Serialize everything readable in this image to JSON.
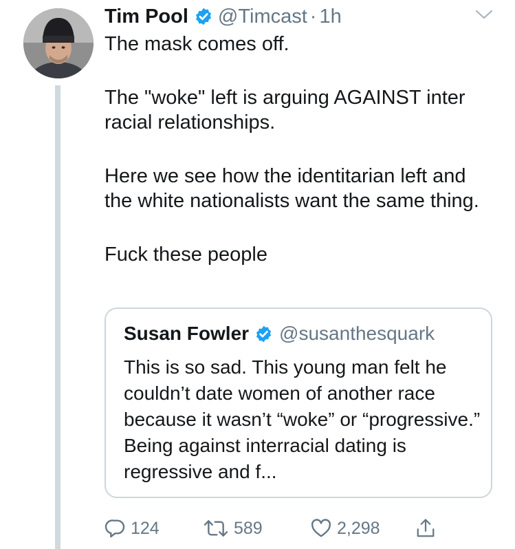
{
  "tweet": {
    "author_name": "Tim Pool",
    "handle": "@Timcast",
    "separator": "·",
    "time": "1h",
    "paragraphs": [
      "The mask comes off.",
      "The \"woke\" left is arguing AGAINST inter racial relationships.",
      "Here we see how the identitarian left and the white nationalists want the same thing.",
      "Fuck these people"
    ]
  },
  "quoted_tweet": {
    "author_name": "Susan Fowler",
    "handle": "@susanthesquark",
    "text": "This is so sad. This young man felt he couldn’t date women of another race because it wasn’t “woke” or “progressive.” Being against interracial dating is regressive and f..."
  },
  "actions": {
    "reply_count": "124",
    "retweet_count": "589",
    "like_count": "2,298"
  },
  "colors": {
    "text": "#14171a",
    "muted": "#657786",
    "verified_blue": "#1da1f2",
    "border": "#ccd6dd",
    "thread_line": "#cfd9de"
  },
  "icons": [
    "verified-badge-icon",
    "chevron-down-icon",
    "reply-icon",
    "retweet-icon",
    "like-icon",
    "share-icon"
  ]
}
